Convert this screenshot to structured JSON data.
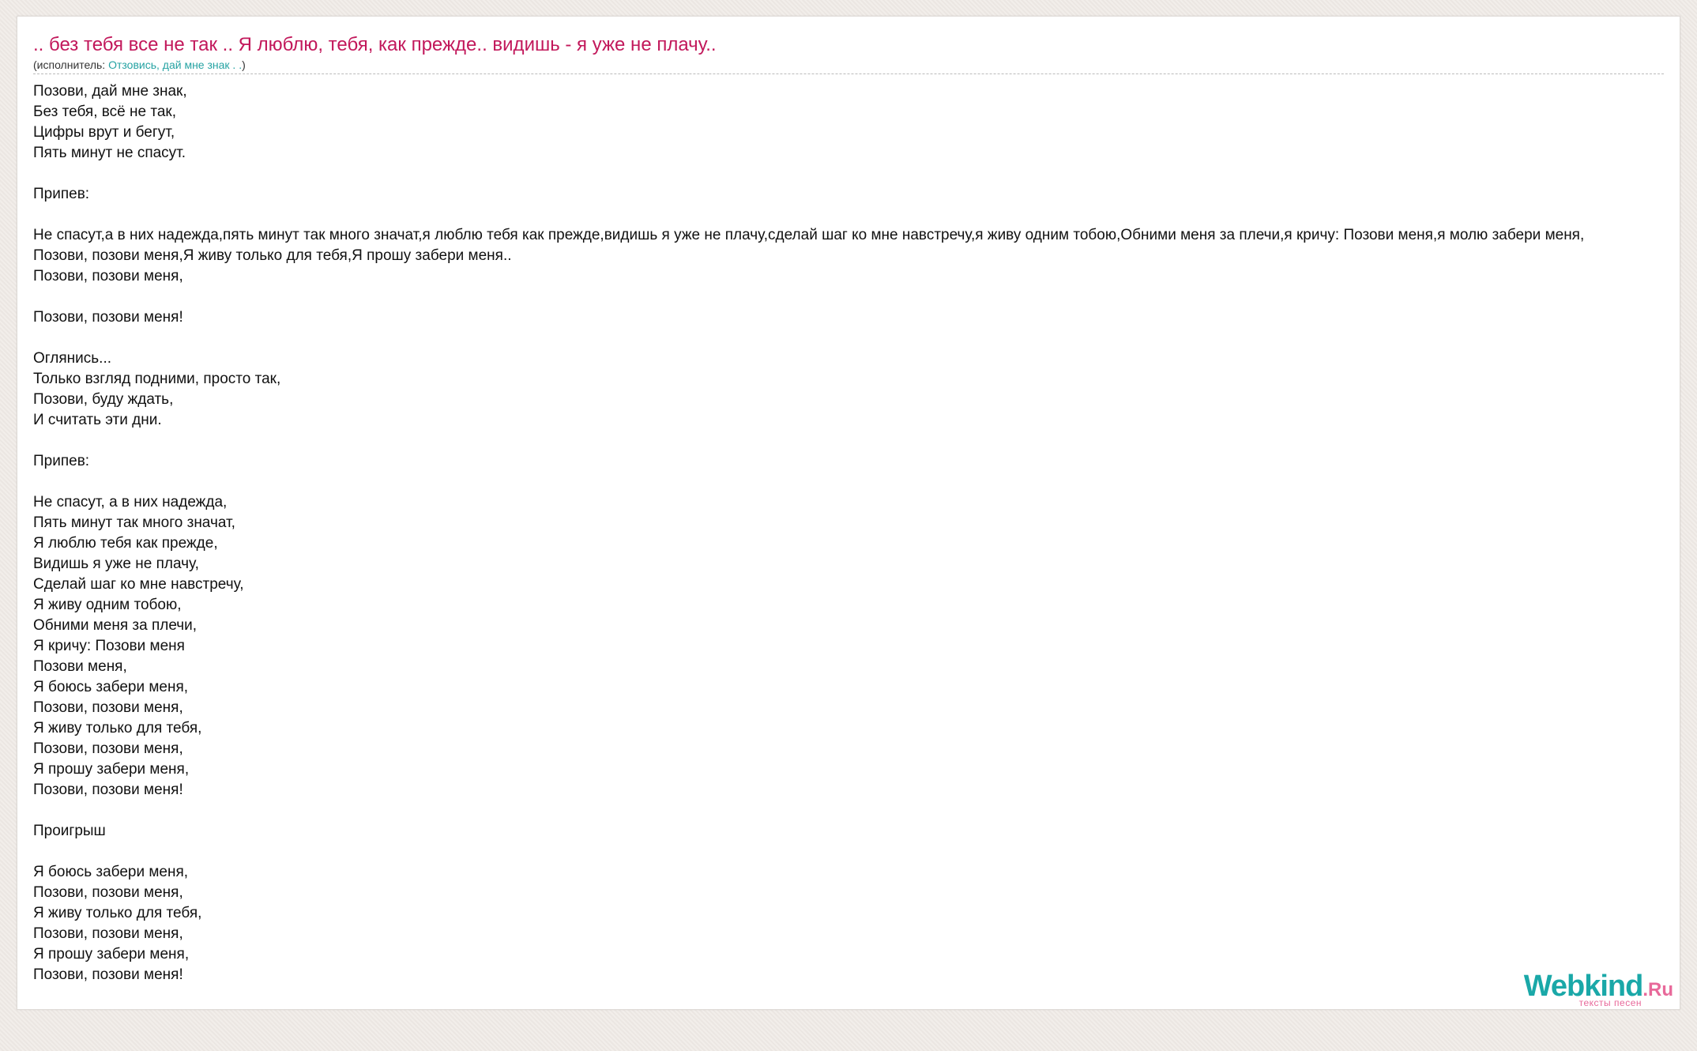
{
  "song": {
    "title": ".. без тебя все не так .. Я люблю, тебя, как прежде.. видишь - я уже не плачу..",
    "performer_prefix": "(исполнитель: ",
    "performer_name": "Отзовись, дай мне знак . .",
    "performer_suffix": ")",
    "lyrics": "Позови, дай мне знак,\nБез тебя, всё не так,\nЦифры врут и бегут,\nПять минут не спасут.\n\nПрипев:\n\nНе спасут,а в них надежда,пять минут так много значат,я люблю тебя как прежде,видишь я уже не плачу,сделай шаг ко мне навстречу,я живу одним тобою,Обними меня за плечи,я кричу: Позови меня,я молю забери меня,\nПозови, позови меня,Я живу только для тебя,Я прошу забери меня..\nПозови, позови меня,\n\nПозови, позови меня!\n\nОглянись...\nТолько взгляд подними, просто так,\nПозови, буду ждать,\nИ считать эти дни.\n\nПрипев:\n\nНе спасут, а в них надежда,\nПять минут так много значат,\nЯ люблю тебя как прежде,\nВидишь я уже не плачу,\nСделай шаг ко мне навстречу,\nЯ живу одним тобою,\nОбними меня за плечи,\nЯ кричу: Позови меня\nПозови меня,\nЯ боюсь забери меня,\nПозови, позови меня,\nЯ живу только для тебя,\nПозови, позови меня,\nЯ прошу забери меня,\nПозови, позови меня!\n\nПроигрыш\n\nЯ боюсь забери меня,\nПозови, позови меня,\nЯ живу только для тебя,\nПозови, позови меня,\nЯ прошу забери меня,\nПозови, позови меня!"
  },
  "logo": {
    "name": "Webkind",
    "tld": ".Ru",
    "subtitle": "тексты песен"
  },
  "colors": {
    "title": "#c2185b",
    "link": "#26a3a3",
    "logo_primary": "#1aa8a8",
    "logo_accent": "#e8699a",
    "background": "#efeae6"
  }
}
